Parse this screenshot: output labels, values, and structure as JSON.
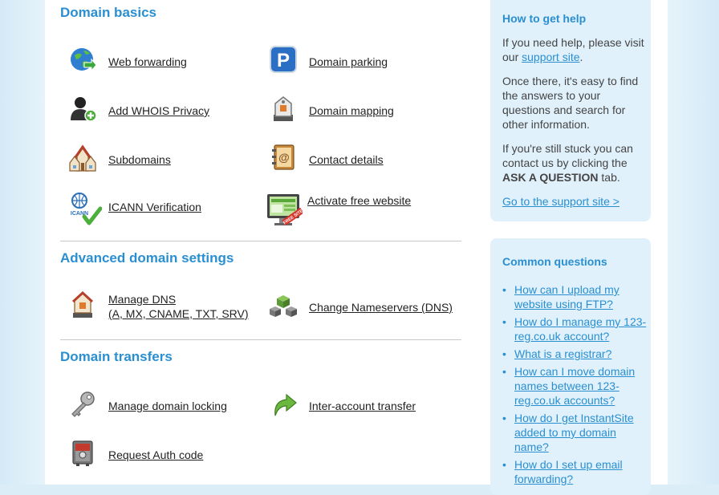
{
  "sections": {
    "basics_title": "Domain basics",
    "advanced_title": "Advanced domain settings",
    "transfers_title": "Domain transfers"
  },
  "basics": {
    "web_forwarding": "Web forwarding",
    "domain_parking": "Domain parking",
    "whois_privacy": "Add WHOIS Privacy",
    "domain_mapping": "Domain mapping",
    "subdomains": "Subdomains",
    "contact_details": "Contact details",
    "icann_verification": "ICANN Verification",
    "activate_website": "Activate free website",
    "icann_icon_text": "ICANN",
    "free_site_badge": "FREE SITE"
  },
  "advanced": {
    "manage_dns_line1": "Manage DNS",
    "manage_dns_line2": "(A, MX, CNAME, TXT, SRV)",
    "change_nameservers": "Change Nameservers (DNS)"
  },
  "transfers": {
    "domain_locking": "Manage domain locking",
    "inter_account": "Inter-account transfer",
    "auth_code": "Request Auth code"
  },
  "help": {
    "title": "How to get help",
    "p1_pre": "If you need help, please visit our ",
    "p1_link": "support site",
    "p1_post": ".",
    "p2": "Once there, it's easy to find the answers to your questions and search for other information.",
    "p3_pre": "If you're still stuck you can contact us by clicking the ",
    "p3_bold": "ASK A QUESTION",
    "p3_post": " tab.",
    "cta": "Go to the support site >"
  },
  "common": {
    "title": "Common questions",
    "questions": [
      "How can I upload my website using FTP?",
      "How do I manage my 123-reg.co.uk account?",
      "What is a registrar?",
      "How can I move domain names between 123-reg.co.uk accounts?",
      "How do I get InstantSite added to my domain name?",
      "How do I set up email forwarding?"
    ]
  },
  "colors": {
    "accent": "#2a8fd1",
    "panel": "#e0f1fb",
    "page_bg": "#dbeef8"
  }
}
